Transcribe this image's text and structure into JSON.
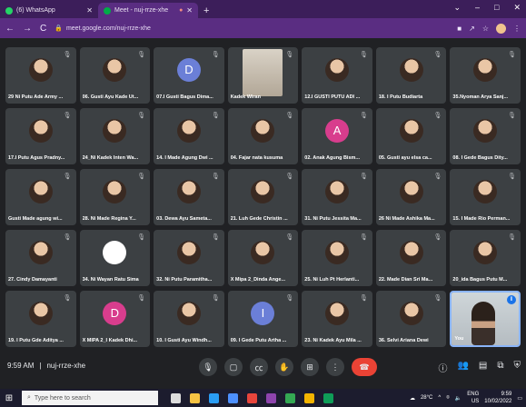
{
  "browser": {
    "tabs": [
      {
        "label": "(6) WhatsApp",
        "favicon_color": "#25d366",
        "active": false
      },
      {
        "label": "Meet - nuj-rrze-xhe",
        "favicon_color": "#00ac47",
        "active": true
      }
    ],
    "url": "meet.google.com/nuj-rrze-xhe"
  },
  "participants": [
    {
      "name": "29 Ni Putu Ade Army ...",
      "pic": "photo"
    },
    {
      "name": "06. Gusti Ayu Kade Ut...",
      "pic": "photo"
    },
    {
      "name": "07.I Gusti Bagus Dima...",
      "pic": "letter",
      "letter": "D",
      "color": "blue"
    },
    {
      "name": "Kadek Wiran",
      "pic": "cam"
    },
    {
      "name": "12.I GUSTI PUTU ADI ...",
      "pic": "photo"
    },
    {
      "name": "18. I Putu Budiarta",
      "pic": "photo"
    },
    {
      "name": "35.Nyoman Arya Sanj...",
      "pic": "photo"
    },
    {
      "name": "17.I Putu Agus Pradny...",
      "pic": "photo"
    },
    {
      "name": "24_Ni Kadek Inten Wa...",
      "pic": "photo"
    },
    {
      "name": "14. I Made Agung Dwi ...",
      "pic": "photo"
    },
    {
      "name": "04. Fajar nata kusuma",
      "pic": "photo"
    },
    {
      "name": "02. Anak Agung Bism...",
      "pic": "letter",
      "letter": "A",
      "color": "pink"
    },
    {
      "name": "05. Gusti ayu elsa ca...",
      "pic": "photo"
    },
    {
      "name": "08. I Gede Bagus Dity...",
      "pic": "photo"
    },
    {
      "name": "Gusti Made agung wi...",
      "pic": "photo"
    },
    {
      "name": "28. Ni Made Regina Y...",
      "pic": "photo"
    },
    {
      "name": "03. Dewa Ayu Sameta...",
      "pic": "photo"
    },
    {
      "name": "21. Luh Gede Christin ...",
      "pic": "photo"
    },
    {
      "name": "31. Ni Putu Jessita Ma...",
      "pic": "photo"
    },
    {
      "name": "26 Ni Made Ashika Ma...",
      "pic": "photo"
    },
    {
      "name": "15. I Made Rio Perman...",
      "pic": "photo"
    },
    {
      "name": "27. Cindy Damayanti",
      "pic": "photo"
    },
    {
      "name": "34. Ni Wayan Ratu Sima",
      "pic": "white"
    },
    {
      "name": "32. Ni Putu Paramitha...",
      "pic": "photo"
    },
    {
      "name": "X Mipa 2_Dinda Ange...",
      "pic": "photo"
    },
    {
      "name": "25. Ni Luh Pt Herlanti...",
      "pic": "photo"
    },
    {
      "name": "22. Made Dian Sri Ma...",
      "pic": "photo"
    },
    {
      "name": "20_ida Bagus Putu M...",
      "pic": "photo"
    },
    {
      "name": "19. I Putu Gde Aditya ...",
      "pic": "photo"
    },
    {
      "name": "X MIPA 2_I Kadek Dhi...",
      "pic": "letter",
      "letter": "D",
      "color": "pink"
    },
    {
      "name": "10. I Gusti Ayu Windh...",
      "pic": "photo"
    },
    {
      "name": "09. I Gede Putu Artha ...",
      "pic": "letter",
      "letter": "I",
      "color": "blue"
    },
    {
      "name": "23. Ni Kadek Ayu Mila ...",
      "pic": "photo"
    },
    {
      "name": "36. Selvi Ariana Dewi",
      "pic": "photo"
    },
    {
      "name": "You",
      "pic": "self"
    }
  ],
  "meeting": {
    "time": "9:59 AM",
    "code": "nuj-rrze-xhe"
  },
  "taskbar": {
    "search_placeholder": "Type here to search",
    "weather": "28°C",
    "lang": "ENG",
    "region": "US",
    "time": "9:59",
    "date": "10/02/2022"
  },
  "colors": {
    "browser_bg": "#5a2d82",
    "tile_bg": "#3c4043",
    "end_call": "#ea4335",
    "self_border": "#8ab4f8"
  }
}
